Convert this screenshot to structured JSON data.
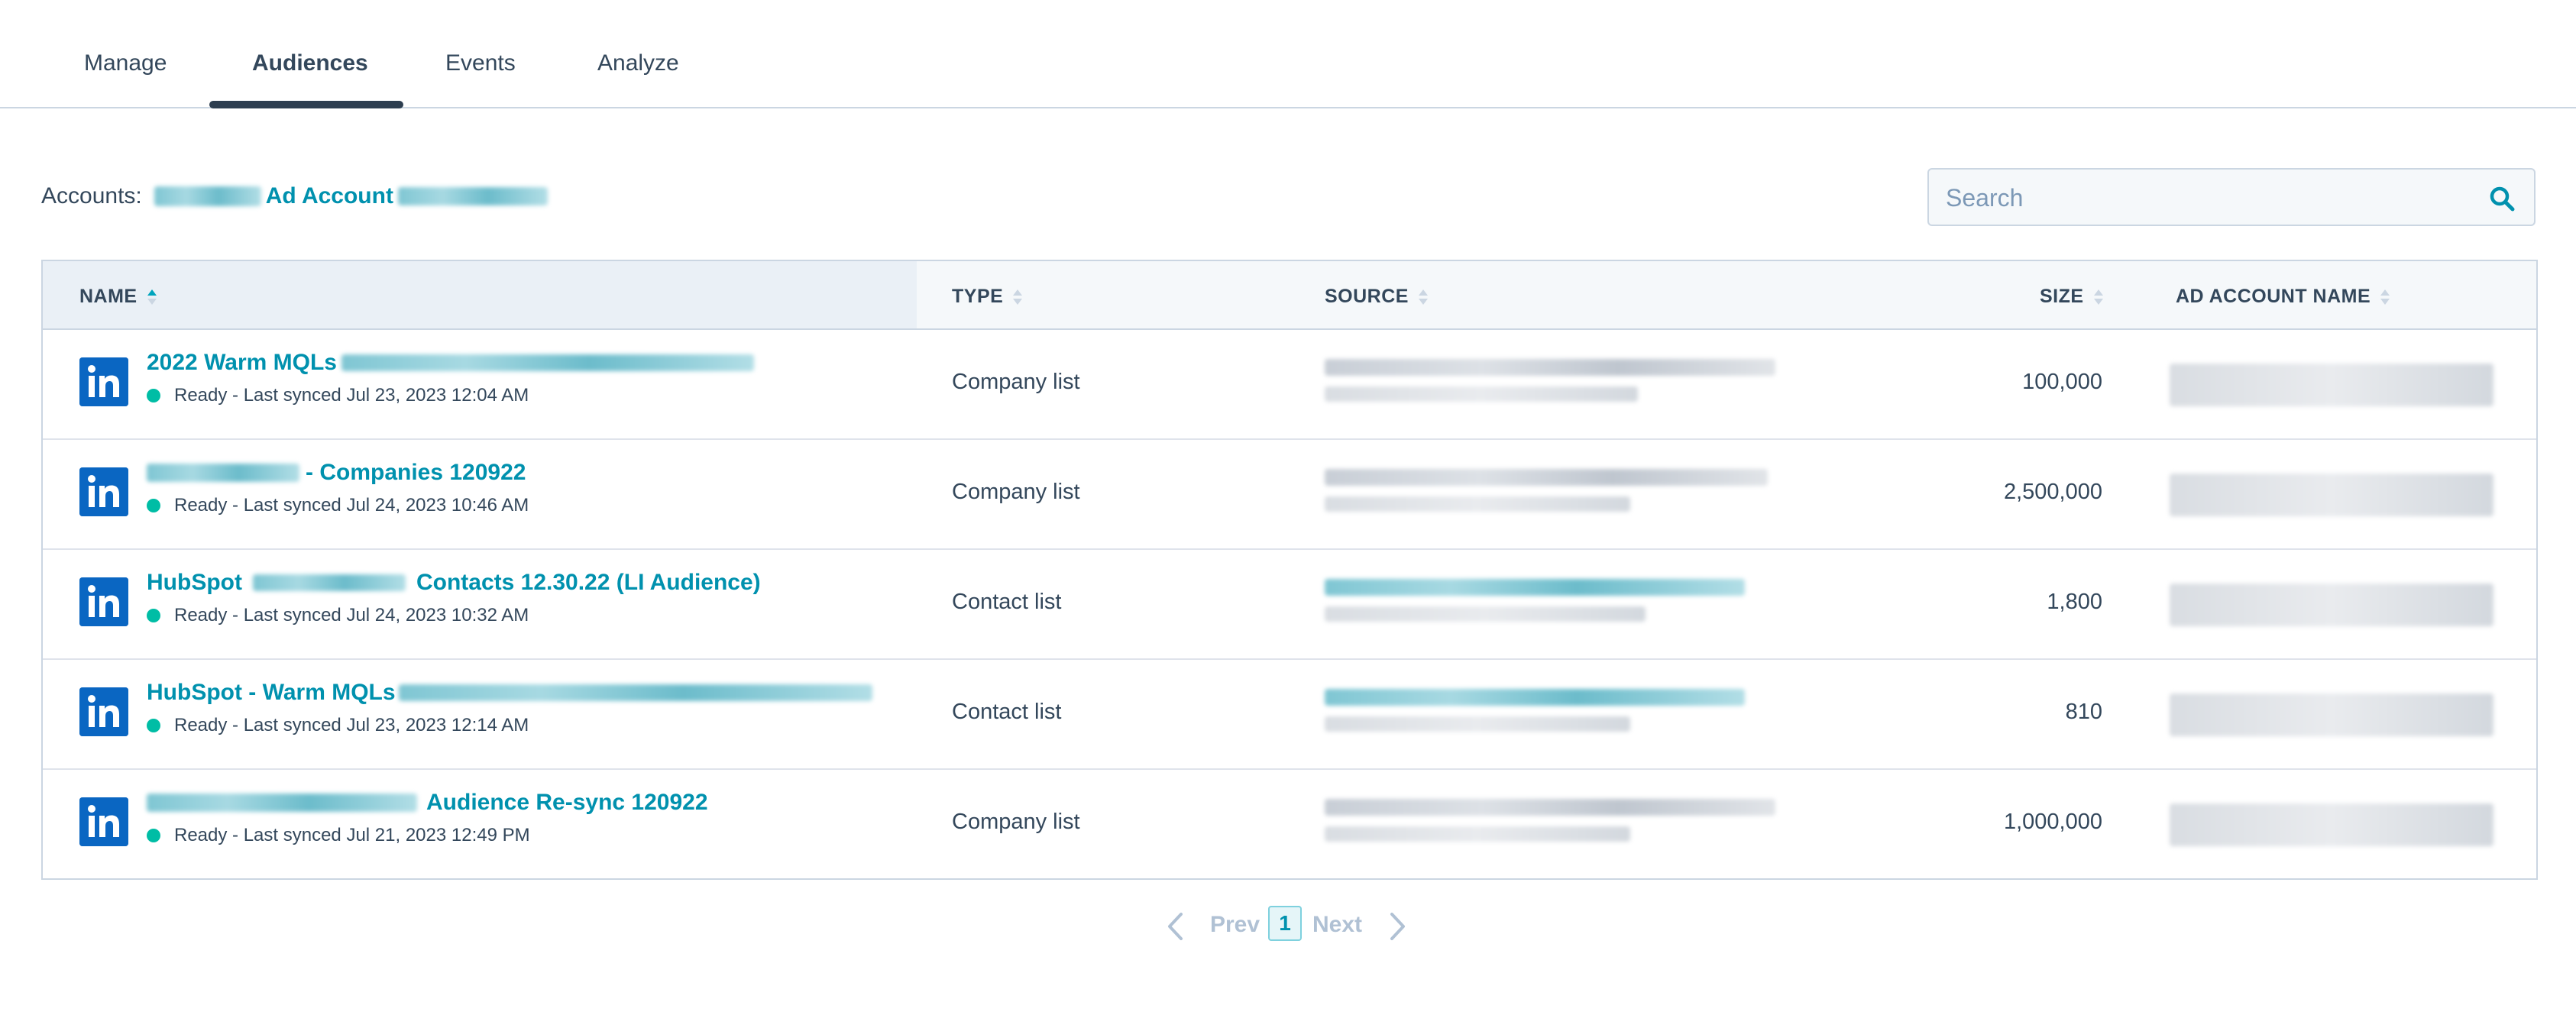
{
  "tabs": [
    {
      "label": "Manage",
      "active": false
    },
    {
      "label": "Audiences",
      "active": true
    },
    {
      "label": "Events",
      "active": false
    },
    {
      "label": "Analyze",
      "active": false
    }
  ],
  "accounts": {
    "label": "Accounts:",
    "account_link": "Ad Account"
  },
  "search": {
    "placeholder": "Search"
  },
  "table": {
    "columns": [
      {
        "label": "NAME",
        "sort": "ascending"
      },
      {
        "label": "TYPE",
        "sort": "none"
      },
      {
        "label": "SOURCE",
        "sort": "none"
      },
      {
        "label": "SIZE",
        "sort": "none"
      },
      {
        "label": "AD ACCOUNT NAME",
        "sort": "none"
      }
    ],
    "rows": [
      {
        "name": "2022 Warm MQLs",
        "name_suffix": "",
        "status": "Ready - Last synced Jul 23, 2023 12:04 AM",
        "type": "Company list",
        "size": "100,000"
      },
      {
        "name": "",
        "name_suffix": "- Companies 120922",
        "status": "Ready - Last synced Jul 24, 2023 10:46 AM",
        "type": "Company list",
        "size": "2,500,000"
      },
      {
        "name": "HubSpot",
        "name_suffix": "Contacts 12.30.22 (LI Audience)",
        "status": "Ready - Last synced Jul 24, 2023 10:32 AM",
        "type": "Contact list",
        "size": "1,800"
      },
      {
        "name": "HubSpot - Warm MQLs",
        "name_suffix": "",
        "status": "Ready - Last synced Jul 23, 2023 12:14 AM",
        "type": "Contact list",
        "size": "810"
      },
      {
        "name": "",
        "name_suffix": "Audience Re-sync 120922",
        "status": "Ready - Last synced Jul 21, 2023 12:49 PM",
        "type": "Company list",
        "size": "1,000,000"
      }
    ]
  },
  "pagination": {
    "prev_label": "Prev",
    "current_page": "1",
    "next_label": "Next"
  },
  "colors": {
    "accent": "#0091ae",
    "status_ready": "#00bda5",
    "linkedin": "#0a66c2",
    "tab_underline": "#2d3e50"
  }
}
